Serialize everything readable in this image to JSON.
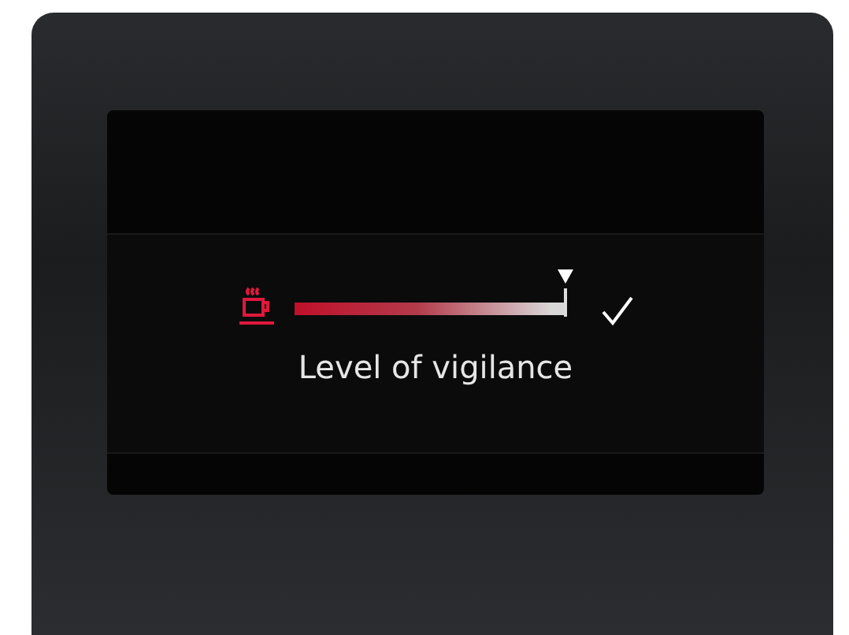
{
  "vigilance": {
    "level": 0.94,
    "confirmed": true,
    "label": "Level of vigilance"
  }
}
